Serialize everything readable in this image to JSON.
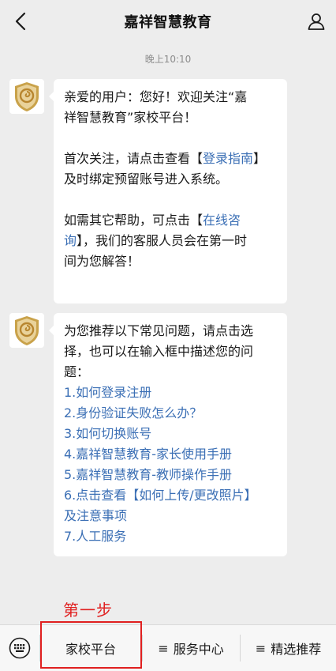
{
  "header": {
    "title": "嘉祥智慧教育"
  },
  "timestamp": "晚上10:10",
  "messages": [
    {
      "lines": [
        [
          "亲爱的用户：您好！欢迎关注“嘉",
          "祥智慧教育”家校平台！"
        ],
        [
          "首次关注，请点击查看",
          "【",
          "登录指南",
          "】",
          "及时绑定预留账号进入系统。"
        ],
        [
          "如需其它帮助，可点击",
          "【",
          "在线咨",
          "询",
          "】，我们的客服人员会在第一时",
          "间为您解答！"
        ]
      ]
    },
    {
      "intro": [
        "为您推荐以下常见问题，请点击选",
        "择，也可以在输入框中描述您的问",
        "题："
      ],
      "items": [
        "1.如何登录注册",
        "2.身份验证失败怎么办？",
        "3.如何切换账号",
        "4.嘉祥智慧教育-家长使用手册",
        "5.嘉祥智慧教育-教师操作手册",
        "6.点击查看【如何上传/更改照片】",
        "及注意事项",
        "7.人工服务"
      ]
    }
  ],
  "annotation": {
    "step": "第一步"
  },
  "menu": {
    "items": [
      {
        "label": "家校平台",
        "prefix": ""
      },
      {
        "label": "服务中心",
        "prefix": "≡"
      },
      {
        "label": "精选推荐",
        "prefix": "≡"
      }
    ]
  },
  "colors": {
    "background": "#ededed",
    "link": "#3b6fb5",
    "annotation": "#e02020"
  }
}
